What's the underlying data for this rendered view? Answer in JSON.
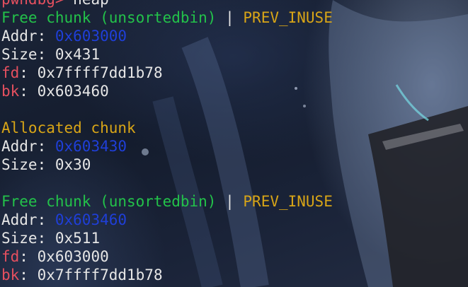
{
  "terminal": {
    "prompt": "pwndbg>",
    "command": "heap",
    "chunks": [
      {
        "header": "Free chunk (unsortedbin)",
        "flag": "PREV_INUSE",
        "addr_label": "Addr:",
        "addr": "0x603000",
        "size_label": "Size:",
        "size": "0x431",
        "fd_label": "fd",
        "fd": "0x7ffff7dd1b78",
        "bk_label": "bk",
        "bk": "0x603460"
      },
      {
        "header": "Allocated chunk",
        "addr_label": "Addr:",
        "addr": "0x603430",
        "size_label": "Size:",
        "size": "0x30"
      },
      {
        "header": "Free chunk (unsortedbin)",
        "flag": "PREV_INUSE",
        "addr_label": "Addr:",
        "addr": "0x603460",
        "size_label": "Size:",
        "size": "0x511",
        "fd_label": "fd",
        "fd": "0x603000",
        "bk_label": "bk",
        "bk": "0x7ffff7dd1b78"
      }
    ],
    "separator": "|"
  },
  "colors": {
    "prompt": "#e5505f",
    "free_header": "#23c24a",
    "allocated_header": "#d8a517",
    "flag": "#d8a517",
    "address": "#1f3fd8",
    "pointer_label": "#e5505f",
    "text": "#e6e6e6"
  }
}
